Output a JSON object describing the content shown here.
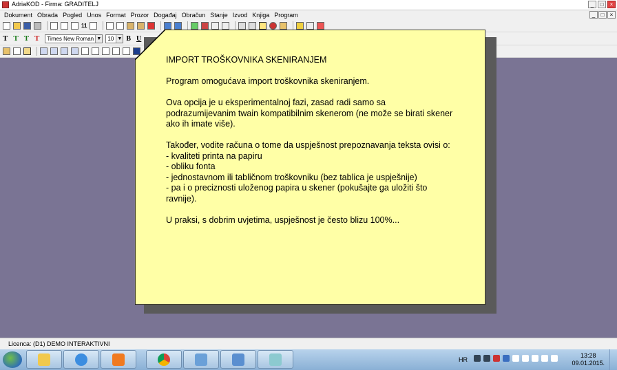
{
  "window": {
    "title": "AdriaKOD - Firma: GRADITELJ",
    "controls": [
      "_",
      "□",
      "×"
    ]
  },
  "menu": {
    "items": [
      "Dokument",
      "Obrada",
      "Pogled",
      "Unos",
      "Format",
      "Prozor",
      "Događaj",
      "Obračun",
      "Stanje",
      "Izvod",
      "Knjiga",
      "Program"
    ]
  },
  "toolbar": {
    "text_styles": [
      "T",
      "T",
      "T",
      "T"
    ],
    "font_name": "Times New Roman",
    "font_size": "10",
    "bold_label": "B",
    "underline_label": "U",
    "page_number_label": "11"
  },
  "note": {
    "title": "IMPORT TROŠKOVNIKA SKENIRANJEM",
    "paragraphs": [
      "Program omogućava import troškovnika skeniranjem.",
      "Ova opcija je u eksperimentalnoj fazi, zasad radi samo sa podrazumijevanim twain kompatibilnim skenerom (ne može se birati skener ako ih imate više)."
    ],
    "intro": "Također, vodite računa o tome da uspješnost prepoznavanja teksta ovisi o:",
    "list": [
      "- kvaliteti printa na papiru",
      "- obliku fonta",
      "- jednostavnom ili tabličnom troškovniku (bez tablica je uspješnije)",
      "- pa i o preciznosti uloženog papira u skener (pokušajte ga uložiti što ravnije)."
    ],
    "closing": "U praksi, s dobrim uvjetima, uspješnost je često blizu 100%...",
    "colors": {
      "background": "#ffffa6",
      "border": "#000000",
      "shadow": "#5a5a5a"
    }
  },
  "status": {
    "license": "Licenca:  (D1) DEMO INTERAKTIVNI"
  },
  "taskbar": {
    "language": "HR",
    "time": "13:28",
    "date": "09.01.2015."
  }
}
